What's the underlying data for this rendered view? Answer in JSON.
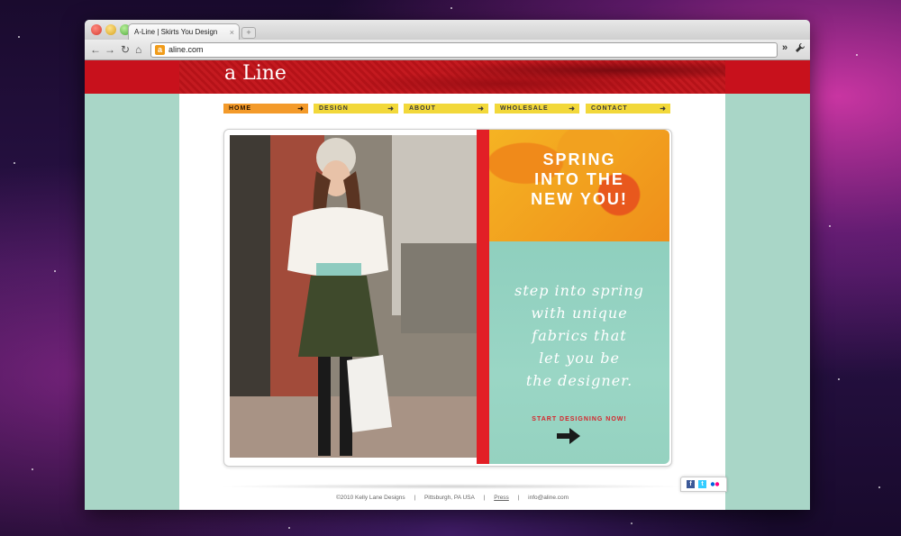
{
  "browser": {
    "tab_title": "A-Line | Skirts You Design",
    "tab_close": "×",
    "new_tab": "+",
    "url": "aline.com",
    "favicon": "a",
    "extend_label": "»",
    "icons": [
      "back-icon",
      "forward-icon",
      "reload-icon",
      "home-icon",
      "wrench-icon"
    ]
  },
  "site": {
    "logo": "a Line",
    "nav": [
      {
        "label": "HOME",
        "active": true
      },
      {
        "label": "DESIGN",
        "active": false
      },
      {
        "label": "ABOUT",
        "active": false
      },
      {
        "label": "WHOLESALE",
        "active": false
      },
      {
        "label": "CONTACT",
        "active": false
      }
    ],
    "nav_arrow": "➜",
    "promo": {
      "headline": "SPRING\nINTO THE\nNEW YOU!",
      "body": "step into spring\nwith unique\nfabrics that\nlet you be\nthe designer.",
      "cta": "START DESIGNING NOW!"
    },
    "footer": {
      "copyright": "©2010 Kelly Lane Designs",
      "sep1": "|",
      "location": "Pittsburgh, PA USA",
      "sep2": "|",
      "press": "Press",
      "sep3": "|",
      "email": "info@aline.com"
    },
    "social": {
      "facebook": "f",
      "twitter": "t",
      "flickr": "••"
    }
  },
  "colors": {
    "brand_red": "#c8111c",
    "nav_yellow": "#f2d83a",
    "nav_active": "#f39a2a",
    "mint": "#a9d6c7",
    "promo_orange": "#f5b323",
    "cta_red": "#d6242b"
  }
}
